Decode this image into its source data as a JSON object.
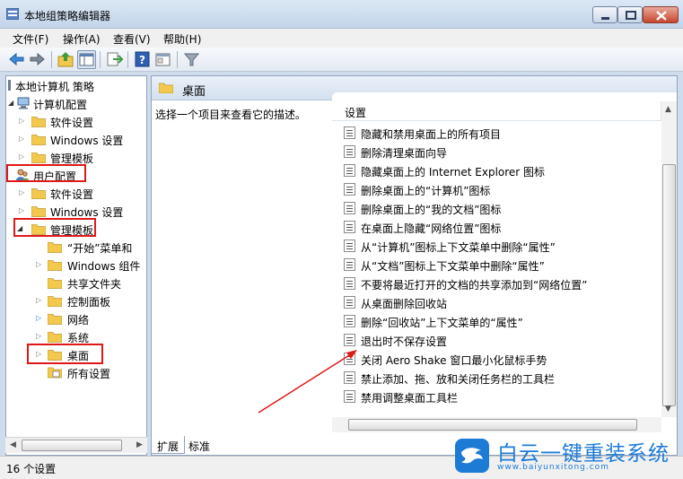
{
  "window": {
    "title": "本地组策略编辑器"
  },
  "menu": [
    "文件(F)",
    "操作(A)",
    "查看(V)",
    "帮助(H)"
  ],
  "toolbar": {
    "icons": [
      "back-arrow-icon",
      "forward-arrow-icon",
      "up-folder-icon",
      "show-hide-tree-icon",
      "export-list-icon",
      "help-icon",
      "properties-icon",
      "filter-icon"
    ]
  },
  "tree": {
    "root": "本地计算机 策略",
    "computer_config": "计算机配置",
    "cc_software": "软件设置",
    "cc_windows": "Windows 设置",
    "cc_admin": "管理模板",
    "user_config": "用户配置",
    "uc_software": "软件设置",
    "uc_windows": "Windows 设置",
    "uc_admin": "管理模板",
    "start_menu": "“开始”菜单和",
    "win_components": "Windows 组件",
    "shared_folders": "共享文件夹",
    "control_panel": "控制面板",
    "network": "网络",
    "system": "系统",
    "desktop": "桌面",
    "all_settings": "所有设置"
  },
  "right": {
    "header": "桌面",
    "description": "选择一个项目来查看它的描述。",
    "column": "设置",
    "settings": [
      "隐藏和禁用桌面上的所有项目",
      "删除清理桌面向导",
      "隐藏桌面上的 Internet Explorer 图标",
      "删除桌面上的“计算机”图标",
      "删除桌面上的“我的文档”图标",
      "在桌面上隐藏“网络位置”图标",
      "从“计算机”图标上下文菜单中删除“属性”",
      "从“文档”图标上下文菜单中删除“属性”",
      "不要将最近打开的文档的共享添加到“网络位置”",
      "从桌面删除回收站",
      "删除“回收站”上下文菜单的“属性”",
      "退出时不保存设置",
      "关闭 Aero Shake 窗口最小化鼠标手势",
      "禁止添加、拖、放和关闭任务栏的工具栏",
      "禁用调整桌面工具栏"
    ]
  },
  "tabs": {
    "extended": "扩展",
    "standard": "标准"
  },
  "status": "16 个设置",
  "watermark": {
    "title": "白云一键重装系统",
    "url": "www.baiyunxitong.com"
  },
  "colors": {
    "highlight_box": "#e01818",
    "folder": "#f2c94c",
    "watermark": "#1d7bd6"
  }
}
